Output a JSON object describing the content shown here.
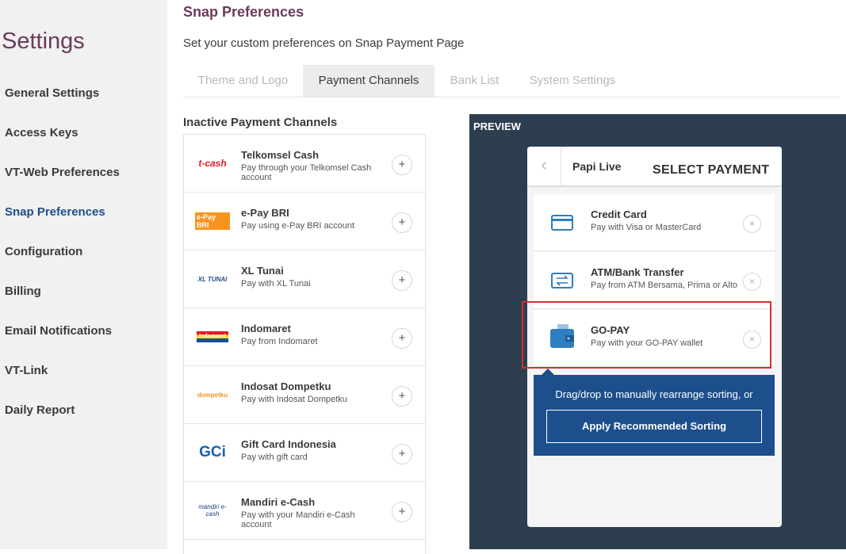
{
  "sidebar": {
    "title": "Settings",
    "items": [
      {
        "label": "General Settings"
      },
      {
        "label": "Access Keys"
      },
      {
        "label": "VT-Web Preferences"
      },
      {
        "label": "Snap Preferences",
        "active": true
      },
      {
        "label": "Configuration"
      },
      {
        "label": "Billing"
      },
      {
        "label": "Email Notifications"
      },
      {
        "label": "VT-Link"
      },
      {
        "label": "Daily Report"
      }
    ]
  },
  "page": {
    "title": "Snap Preferences",
    "subtitle": "Set your custom preferences on Snap Payment Page"
  },
  "tabs": [
    {
      "label": "Theme and Logo"
    },
    {
      "label": "Payment Channels",
      "active": true
    },
    {
      "label": "Bank List"
    },
    {
      "label": "System Settings"
    }
  ],
  "inactive": {
    "title": "Inactive Payment Channels",
    "add_symbol": "+",
    "channels": [
      {
        "name": "Telkomsel Cash",
        "desc": "Pay through your Telkomsel Cash account",
        "logo_text": "t-cash",
        "logo_color": "#e21b23"
      },
      {
        "name": "e-Pay BRI",
        "desc": "Pay using e-Pay BRI account",
        "logo_text": "e-Pay BRI",
        "logo_color": "#f7941d"
      },
      {
        "name": "XL Tunai",
        "desc": "Pay with XL Tunai",
        "logo_text": "XL TUNAI",
        "logo_color": "#1c4f8c"
      },
      {
        "name": "Indomaret",
        "desc": "Pay from Indomaret",
        "logo_text": "Indomaret",
        "logo_color": "#e21b23"
      },
      {
        "name": "Indosat Dompetku",
        "desc": "Pay with Indosat Dompetku",
        "logo_text": "dompetku",
        "logo_color": "#f7941d"
      },
      {
        "name": "Gift Card Indonesia",
        "desc": "Pay with gift card",
        "logo_text": "GCi",
        "logo_color": "#1a5fae"
      },
      {
        "name": "Mandiri e-Cash",
        "desc": "Pay with your Mandiri e-Cash account",
        "logo_text": "mandiri e-cash",
        "logo_color": "#1c3f7c"
      }
    ]
  },
  "preview": {
    "label": "PREVIEW",
    "back_symbol": "‹",
    "merchant": "Papi Live",
    "header": "SELECT PAYMENT",
    "remove_symbol": "×",
    "methods": [
      {
        "name": "Credit Card",
        "desc": "Pay with Visa or MasterCard",
        "icon": "credit-card-icon"
      },
      {
        "name": "ATM/Bank Transfer",
        "desc": "Pay from ATM Bersama, Prima or Alto",
        "icon": "bank-transfer-icon"
      },
      {
        "name": "GO-PAY",
        "desc": "Pay with your GO-PAY wallet",
        "icon": "wallet-icon"
      }
    ],
    "tooltip_text": "Drag/drop to manually rearrange sorting, or",
    "apply_label": "Apply Recommended Sorting"
  },
  "colors": {
    "accent_blue": "#1c4f8c",
    "title_purple": "#6b3a5b",
    "preview_bg": "#2d3e50",
    "highlight_red": "#d0312d"
  }
}
